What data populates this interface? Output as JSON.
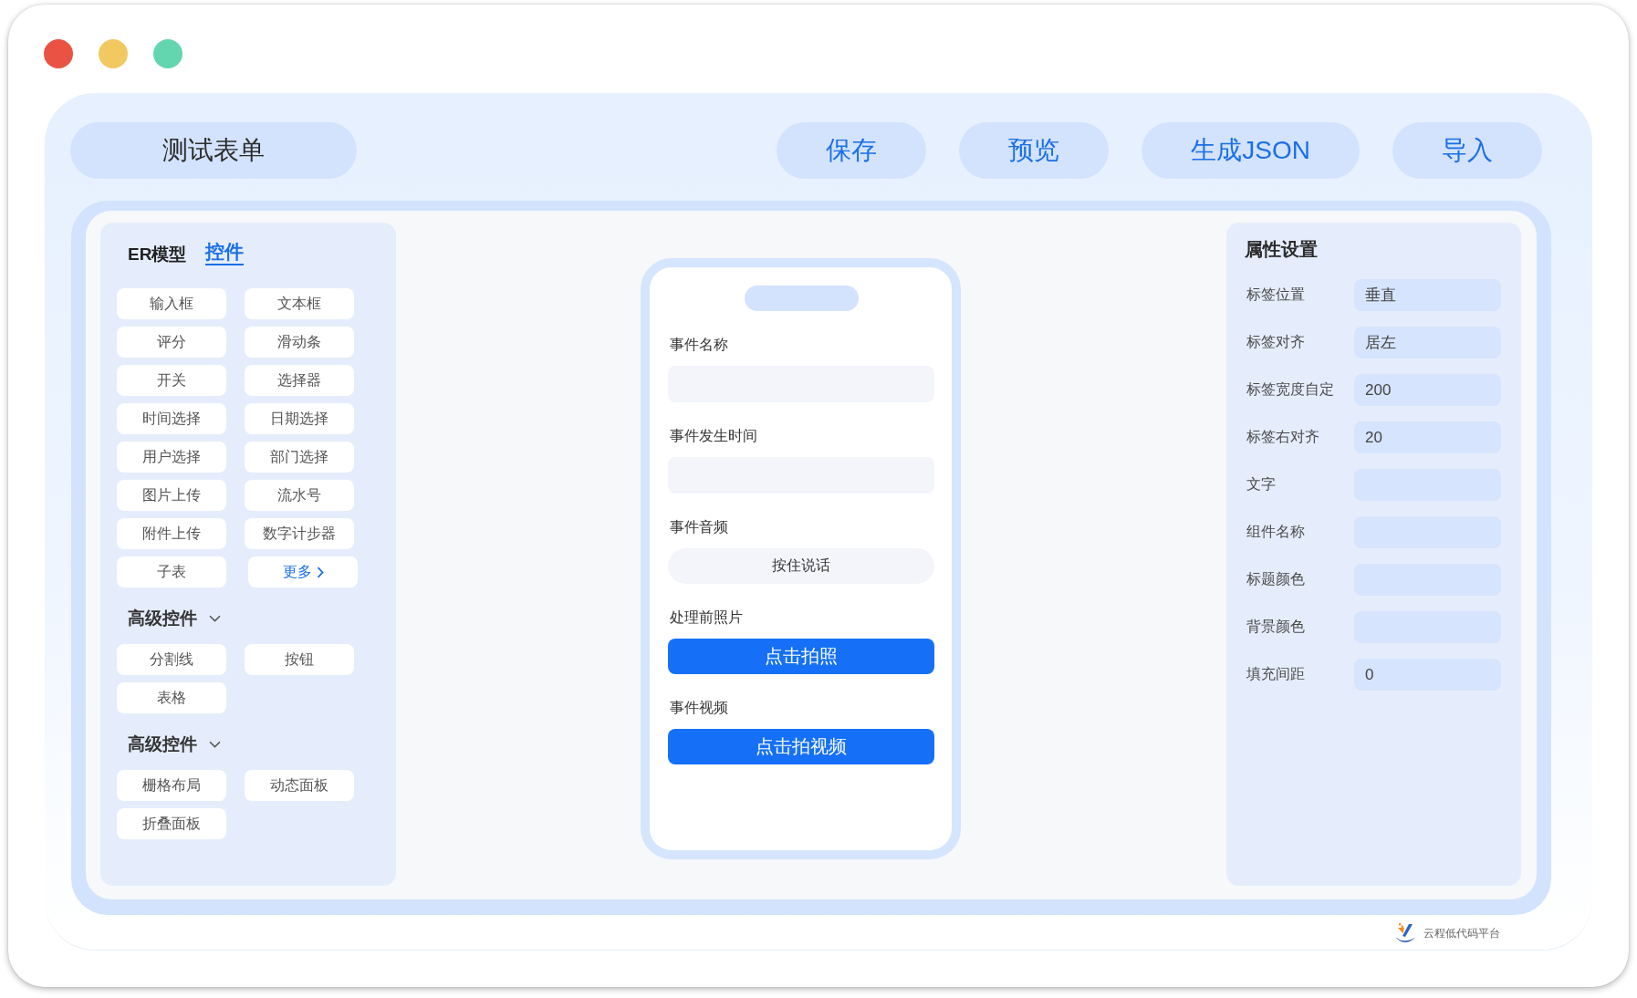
{
  "header": {
    "title": "测试表单",
    "buttons": [
      "保存",
      "预览",
      "生成JSON",
      "导入"
    ]
  },
  "component_panel": {
    "tabs": [
      {
        "label": "ER模型",
        "selected": false
      },
      {
        "label": "控件",
        "selected": true
      }
    ],
    "controls": [
      {
        "label": "输入框",
        "kind": "item"
      },
      {
        "label": "文本框",
        "kind": "item"
      },
      {
        "label": "评分",
        "kind": "item"
      },
      {
        "label": "滑动条",
        "kind": "item"
      },
      {
        "label": "开关",
        "kind": "item"
      },
      {
        "label": "选择器",
        "kind": "item"
      },
      {
        "label": "时间选择",
        "kind": "item"
      },
      {
        "label": "日期选择",
        "kind": "item"
      },
      {
        "label": "用户选择",
        "kind": "item"
      },
      {
        "label": "部门选择",
        "kind": "item"
      },
      {
        "label": "图片上传",
        "kind": "item"
      },
      {
        "label": "流水号",
        "kind": "item"
      },
      {
        "label": "附件上传",
        "kind": "item"
      },
      {
        "label": "数字计步器",
        "kind": "item"
      },
      {
        "label": "子表",
        "kind": "item"
      },
      {
        "label": "更多",
        "kind": "more"
      }
    ],
    "groups": [
      {
        "title": "高级控件",
        "expanded": true,
        "items": [
          "分割线",
          "按钮",
          "表格"
        ]
      },
      {
        "title": "高级控件",
        "expanded": true,
        "items": [
          "栅格布局",
          "动态面板",
          "折叠面板"
        ]
      }
    ]
  },
  "phone_form": {
    "fields": [
      {
        "label": "事件名称",
        "kind": "text"
      },
      {
        "label": "事件发生时间",
        "kind": "text"
      },
      {
        "label": "事件音频",
        "kind": "voice",
        "button": "按住说话"
      },
      {
        "label": "处理前照片",
        "kind": "capture",
        "button": "点击拍照"
      },
      {
        "label": "事件视频",
        "kind": "capture",
        "button": "点击拍视频"
      }
    ]
  },
  "properties": {
    "title": "属性设置",
    "rows": [
      {
        "label": "标签位置",
        "value": "垂直"
      },
      {
        "label": "标签对齐",
        "value": "居左"
      },
      {
        "label": "标签宽度自定",
        "value": "200"
      },
      {
        "label": "标签右对齐",
        "value": "20"
      },
      {
        "label": "文字"
      },
      {
        "label": "组件名称"
      },
      {
        "label": "标题颜色"
      },
      {
        "label": "背景颜色"
      },
      {
        "label": "填充间距",
        "value": "0"
      }
    ]
  },
  "footer": {
    "brand": "云程低代码平台"
  }
}
